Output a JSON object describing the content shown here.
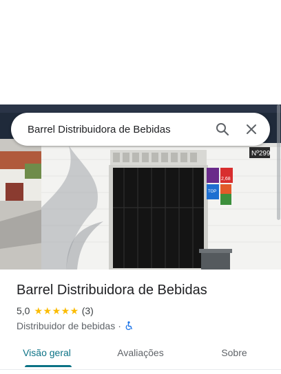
{
  "search": {
    "value": "Barrel Distribuidora de Bebidas"
  },
  "photo": {
    "number_plate": "Nº299",
    "sticker_texts": [
      "TOP",
      "2,68"
    ]
  },
  "place": {
    "name": "Barrel Distribuidora de Bebidas",
    "rating": "5,0",
    "stars": "★★★★★",
    "review_count": "(3)",
    "category": "Distribuidor de bebidas",
    "separator": "·"
  },
  "tabs": [
    {
      "label": "Visão geral",
      "active": true
    },
    {
      "label": "Avaliações",
      "active": false
    },
    {
      "label": "Sobre",
      "active": false
    }
  ],
  "colors": {
    "accent": "#0b7285",
    "star": "#fbbc04",
    "accessibility": "#1a73e8"
  }
}
